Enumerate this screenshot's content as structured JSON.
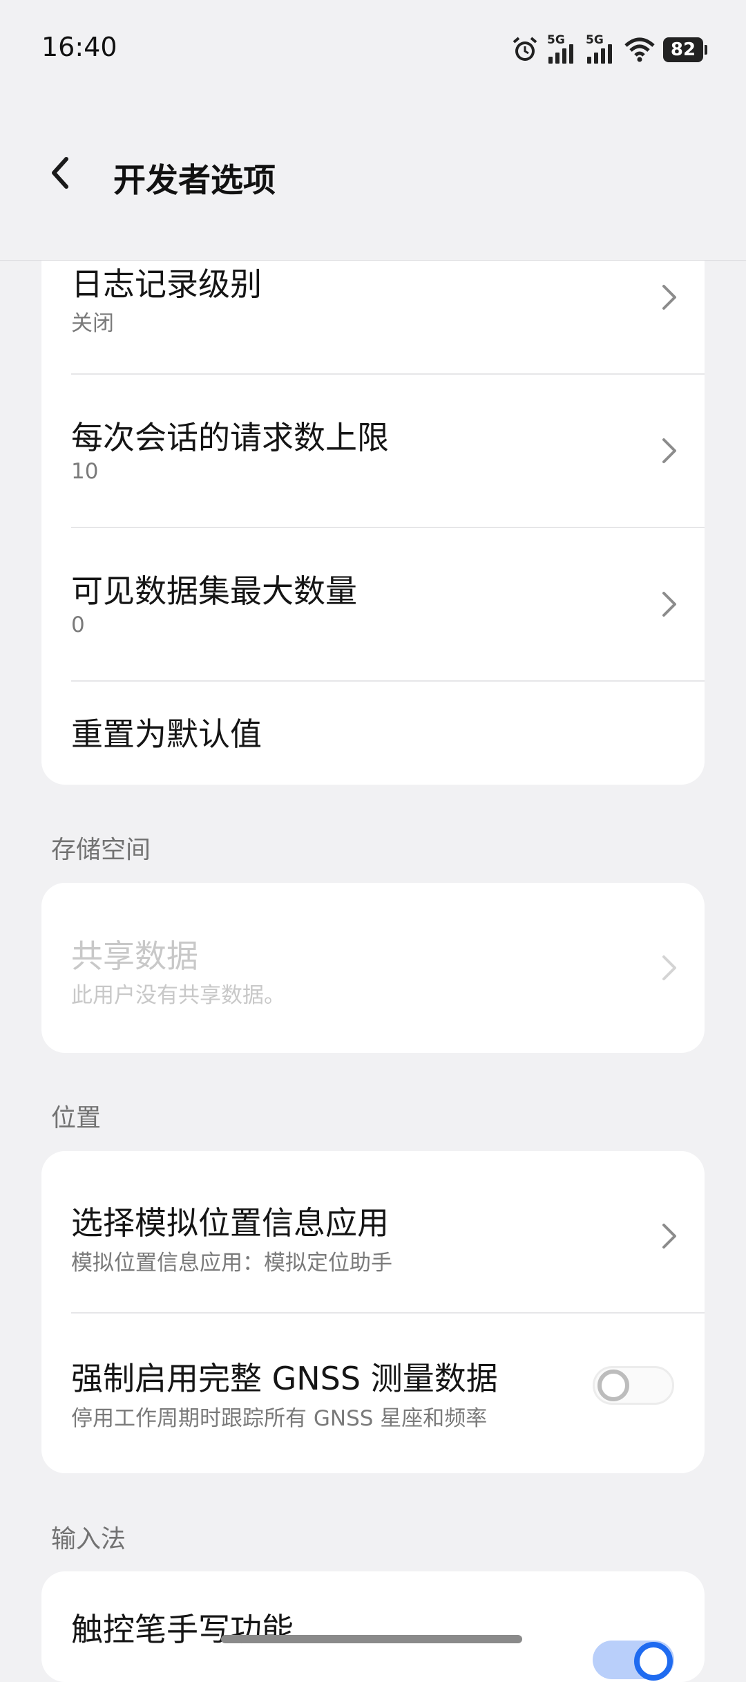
{
  "status_bar": {
    "time": "16:40",
    "signal1_label": "5G",
    "signal2_label": "5G",
    "battery": "82",
    "icons": [
      "alarm-icon",
      "signal-5g-icon",
      "signal-5g-icon",
      "wifi-icon",
      "battery-icon"
    ]
  },
  "header": {
    "back_icon": "chevron-left-icon",
    "title": "开发者选项"
  },
  "card1": {
    "log_level": {
      "title": "日志记录级别",
      "subtitle": "关闭"
    },
    "max_requests": {
      "title": "每次会话的请求数上限",
      "subtitle": "10"
    },
    "max_datasets": {
      "title": "可见数据集最大数量",
      "subtitle": "0"
    },
    "reset": {
      "title": "重置为默认值"
    }
  },
  "storage": {
    "section_label": "存储空间",
    "shared_data": {
      "title": "共享数据",
      "subtitle": "此用户没有共享数据。",
      "enabled": false
    }
  },
  "location": {
    "section_label": "位置",
    "mock_app": {
      "title": "选择模拟位置信息应用",
      "subtitle": "模拟位置信息应用：模拟定位助手"
    },
    "gnss": {
      "title": "强制启用完整 GNSS 测量数据",
      "subtitle": "停用工作周期时跟踪所有 GNSS 星座和频率",
      "toggle_on": false
    }
  },
  "input_method": {
    "section_label": "输入法",
    "stylus": {
      "title": "触控笔手写功能",
      "toggle_on": true
    }
  },
  "colors": {
    "accent": "#1f6bf0",
    "background": "#f1f1f3",
    "card": "#ffffff"
  }
}
